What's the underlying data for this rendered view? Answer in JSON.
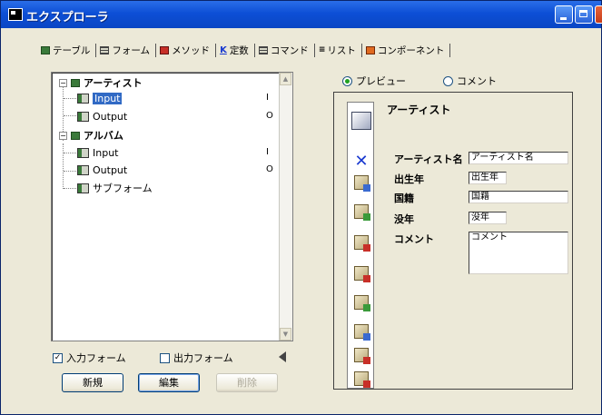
{
  "window": {
    "title": "エクスプローラ"
  },
  "tabs": [
    {
      "label": "テーブル",
      "icon": "table-icon"
    },
    {
      "label": "フォーム",
      "icon": "form-icon"
    },
    {
      "label": "メソッド",
      "icon": "method-icon"
    },
    {
      "label": "定数",
      "icon": "constant-icon"
    },
    {
      "label": "コマンド",
      "icon": "command-icon"
    },
    {
      "label": "リスト",
      "icon": "list-icon"
    },
    {
      "label": "コンポーネント",
      "icon": "component-icon"
    }
  ],
  "tree": {
    "nodes": [
      {
        "label": "アーティスト",
        "children": [
          {
            "label": "Input",
            "value": "I",
            "selected": true
          },
          {
            "label": "Output",
            "value": "O"
          }
        ]
      },
      {
        "label": "アルバム",
        "children": [
          {
            "label": "Input",
            "value": "I"
          },
          {
            "label": "Output",
            "value": "O"
          },
          {
            "label": "サブフォーム",
            "value": ""
          }
        ]
      }
    ]
  },
  "filters": {
    "input_forms": {
      "label": "入力フォーム",
      "checked": true
    },
    "output_forms": {
      "label": "出力フォーム",
      "checked": false
    }
  },
  "buttons": {
    "new": "新規",
    "edit": "編集",
    "delete": "削除"
  },
  "view_mode": {
    "preview": {
      "label": "プレビュー",
      "selected": true
    },
    "comment": {
      "label": "コメント",
      "selected": false
    }
  },
  "preview": {
    "form_title": "アーティスト",
    "fields": [
      {
        "label": "アーティスト名",
        "value": "アーティスト名"
      },
      {
        "label": "出生年",
        "value": "出生年"
      },
      {
        "label": "国籍",
        "value": "国籍"
      },
      {
        "label": "没年",
        "value": "没年"
      },
      {
        "label": "コメント",
        "value": "コメント"
      }
    ]
  }
}
